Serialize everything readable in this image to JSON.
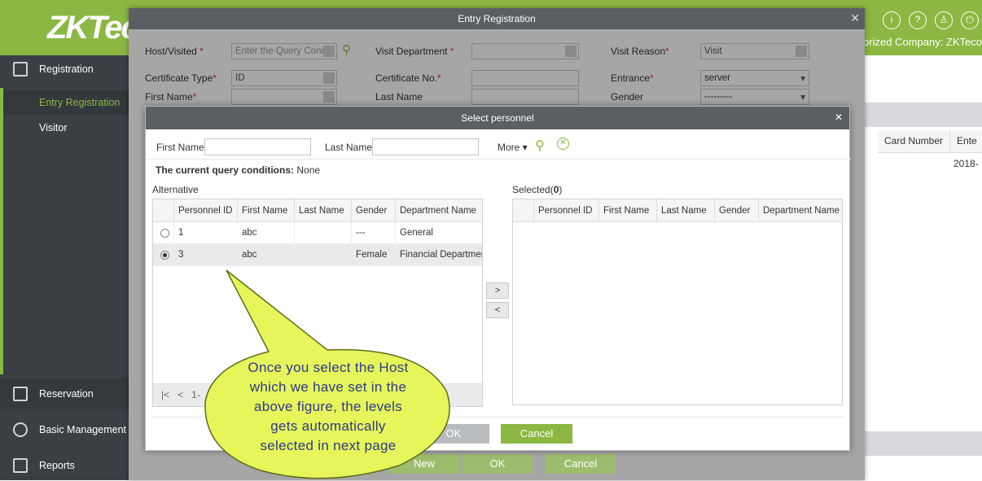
{
  "app": {
    "logo": "ZKTeco",
    "company": "Authorized Company: ZKTeco"
  },
  "sidebar": {
    "registration": "Registration",
    "entry_registration": "Entry Registration",
    "visitor": "Visitor",
    "reservation": "Reservation",
    "basic_management": "Basic Management",
    "reports": "Reports"
  },
  "background": {
    "col_card_number": "Card Number",
    "col_enter": "Ente",
    "date_cell": "2018-"
  },
  "entry_window": {
    "title": "Entry Registration",
    "host_label": "Host/Visited",
    "host_placeholder": "Enter the Query Condi",
    "visit_department_label": "Visit Department",
    "visit_reason_label": "Visit Reason",
    "visit_reason_value": "Visit",
    "certificate_type_label": "Certificate Type",
    "certificate_type_value": "ID",
    "certificate_no_label": "Certificate No.",
    "entrance_label": "Entrance",
    "entrance_value": "server",
    "first_name_label": "First Name",
    "last_name_label": "Last Name",
    "gender_label": "Gender",
    "gender_value": "---------",
    "btn_new": "New",
    "btn_ok": "OK",
    "btn_cancel": "Cancel"
  },
  "dialog": {
    "title": "Select personnel",
    "first_name_label": "First Name",
    "last_name_label": "Last Name",
    "more_label": "More",
    "query_conditions_label": "The current query conditions:",
    "query_conditions_value": "None",
    "alternative_label": "Alternative",
    "selected_label": "Selected(",
    "selected_count": "0",
    "selected_close": ")",
    "columns": [
      "Personnel ID",
      "First Name",
      "Last Name",
      "Gender",
      "Department Name"
    ],
    "rows": [
      {
        "id": "1",
        "first": "abc",
        "last": "",
        "gender": "---",
        "dept": "General",
        "selected": false
      },
      {
        "id": "3",
        "first": "abc",
        "last": "",
        "gender": "Female",
        "dept": "Financial Department",
        "selected": true
      }
    ],
    "pager_text": "1-",
    "move_right": ">",
    "move_left": "<",
    "btn_ok": "OK",
    "btn_cancel": "Cancel"
  },
  "callout": {
    "line1": "Once you select the Host",
    "line2": "which we have set in the",
    "line3": "above figure, the levels",
    "line4": "gets automatically",
    "line5": "selected in next page"
  },
  "colors": {
    "brand_green": "#8ab842",
    "sidebar_dark": "#3a3f44",
    "title_bar": "#5b5f63",
    "callout_fill": "#e6f55a"
  }
}
